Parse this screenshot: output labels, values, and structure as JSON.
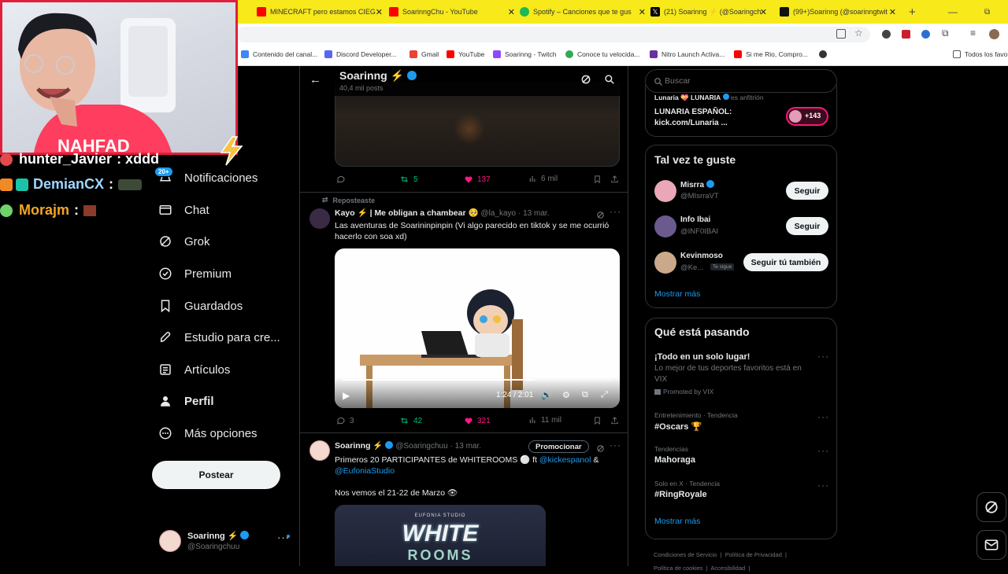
{
  "browser": {
    "tabs": [
      {
        "title": "MINECRAFT pero estamos CIEG",
        "color": "#ff0000"
      },
      {
        "title": "SoarinngChu - YouTube",
        "color": "#ff0000"
      },
      {
        "title": "Spotify – Canciones que te gus",
        "color": "#1db954"
      },
      {
        "title": "(21) Soarinng ⚡ (@Soaringch",
        "color": "#000000"
      },
      {
        "title": "(99+)Soarinng (@soarinngtwit",
        "color": "#111111"
      }
    ],
    "new_tab": "+",
    "bookmarks": [
      {
        "label": "Contenido del canal...",
        "color": "#4285f4"
      },
      {
        "label": "Discord Developer...",
        "color": "#5865f2"
      },
      {
        "label": "Gmail",
        "color": "#ea4335"
      },
      {
        "label": "YouTube",
        "color": "#ff0000"
      },
      {
        "label": "Soarinng - Twitch",
        "color": "#9146ff"
      },
      {
        "label": "Conoce tu velocida...",
        "color": "#34a853"
      },
      {
        "label": "Nitro Launch Activa...",
        "color": "#6b2fa0"
      },
      {
        "label": "Si me Rio, Compro...",
        "color": "#ff0000"
      },
      {
        "label": "Todos los favor",
        "color": "#555555"
      }
    ]
  },
  "chat": [
    {
      "user": "hunter_Javier",
      "text": ": xddd",
      "color": "#ffffff"
    },
    {
      "user": "DemianCX",
      "text": ":",
      "color": "#9fd6ff"
    },
    {
      "user": "Morajm",
      "text": ":",
      "color": "#f5a623"
    }
  ],
  "nav": {
    "badge": "20+",
    "items": [
      {
        "label": "Notificaciones",
        "icon": "bell-icon"
      },
      {
        "label": "Chat",
        "icon": "mail-icon"
      },
      {
        "label": "Grok",
        "icon": "grok-icon"
      },
      {
        "label": "Premium",
        "icon": "premium-icon"
      },
      {
        "label": "Guardados",
        "icon": "bookmark-icon"
      },
      {
        "label": "Estudio para cre...",
        "icon": "rocket-icon"
      },
      {
        "label": "Artículos",
        "icon": "article-icon"
      },
      {
        "label": "Perfil",
        "icon": "person-icon"
      },
      {
        "label": "Más opciones",
        "icon": "more-icon"
      }
    ],
    "post_button": "Postear",
    "account_name": "Soarinng ⚡",
    "account_handle": "@Soaringchuu"
  },
  "header": {
    "name": "Soarinng ⚡",
    "posts": "40,4 mil posts"
  },
  "post1": {
    "replies": "",
    "reposts": "5",
    "likes": "137",
    "views": "6 mil"
  },
  "post2": {
    "reposted_label": "Reposteaste",
    "author": "Kayo ⚡ | Me obligan a chambear 🥺",
    "handle": "@la_kayo",
    "date": "· 13 mar.",
    "text": "Las aventuras de Soarininpinpin (Vi algo parecido en tiktok y se me ocurrió hacerlo con soa xd)",
    "video_time": "1:24 / 2:01",
    "replies": "3",
    "reposts": "42",
    "likes": "321",
    "views": "11 mil"
  },
  "post3": {
    "author": "Soarinng ⚡",
    "handle": "@Soaringchuu",
    "date": "· 13 mar.",
    "promote": "Promocionar",
    "text_pre": "Primeros 20 PARTICIPANTES de WHITEROOMS ⚪ ft ",
    "mention1": "@kickespanol",
    "text_mid": " &",
    "mention2": "@EufoniaStudio",
    "text2": "Nos vemos el 21-22 de Marzo 👁",
    "image_brand": "EUFONIA STUDIO",
    "image_title": "WHITE",
    "image_sub": "ROOMS"
  },
  "search": {
    "placeholder": "Buscar"
  },
  "space": {
    "host": "Lunaria 💝 LUNARIA",
    "host_suffix": "es anfitrión",
    "title1": "LUNARIA ESPAÑOL:",
    "title2": "kick.com/Lunaria ...",
    "count": "+143"
  },
  "who_to_follow": {
    "title": "Tal vez te guste",
    "users": [
      {
        "name": "Misrra",
        "handle": "@MIsrraVT",
        "button": "Seguir",
        "tag": ""
      },
      {
        "name": "Info Ibai",
        "handle": "@INF0IBAI",
        "button": "Seguir",
        "tag": ""
      },
      {
        "name": "Kevinmoso",
        "handle": "@Ke...",
        "button": "Seguir tú también",
        "tag": "Te sigue"
      }
    ],
    "more": "Mostrar más"
  },
  "trends": {
    "title": "Qué está pasando",
    "items": [
      {
        "meta": "",
        "name": "¡Todo en un solo lugar!",
        "desc": "Lo mejor de tus deportes favoritos  está en VIX",
        "promo": "Promoted by VIX"
      },
      {
        "meta": "Entretenimiento · Tendencia",
        "name": "#Oscars 🏆",
        "desc": "",
        "promo": ""
      },
      {
        "meta": "Tendencias",
        "name": "Mahoraga",
        "desc": "",
        "promo": ""
      },
      {
        "meta": "Solo en X · Tendencia",
        "name": "#RingRoyale",
        "desc": "",
        "promo": ""
      }
    ],
    "more": "Mostrar más"
  },
  "footer": {
    "links": [
      "Condiciones de Servicio",
      "Política de Privacidad",
      "Política de cookies",
      "Accesibilidad"
    ]
  },
  "colors": {
    "accent": "#1d9bf0",
    "like": "#f91880",
    "repost": "#00ba7c",
    "webcam_border": "#e0203a",
    "tabbar": "#f7e91a"
  }
}
